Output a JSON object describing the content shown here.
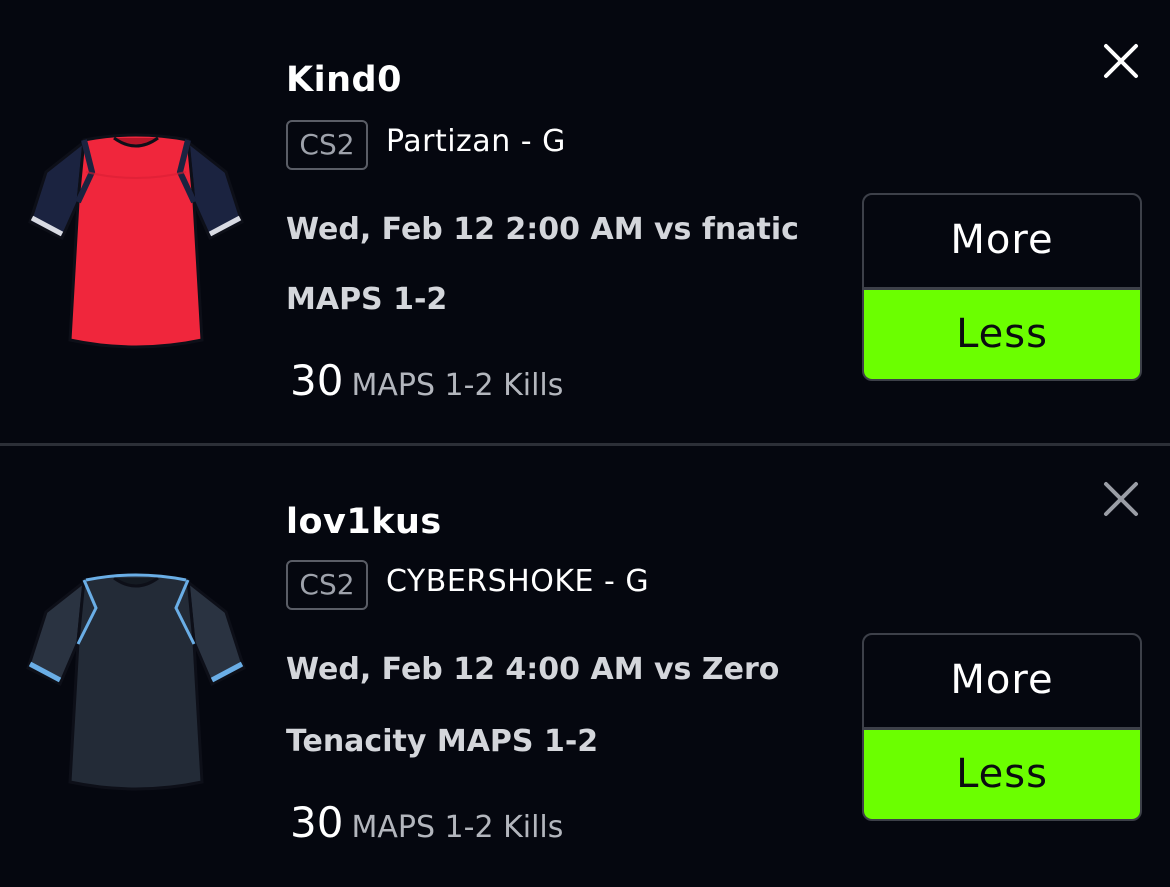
{
  "colors": {
    "background": "#05070f",
    "accent_selected": "#6bff00",
    "divider": "#2c2f37"
  },
  "projections": [
    {
      "player": "Kind0",
      "league": "CS2",
      "team": "Partizan - G",
      "match": "Wed, Feb 12 2:00 AM vs fnatic",
      "description": "MAPS 1-2",
      "line_value": "30",
      "stat": "MAPS 1-2 Kills",
      "more_label": "More",
      "less_label": "Less",
      "selected": "Less",
      "jersey_icon": "red-jersey-icon",
      "close_icon": "close-icon"
    },
    {
      "player": "lov1kus",
      "league": "CS2",
      "team": "CYBERSHOKE - G",
      "match": "Wed, Feb 12 4:00 AM vs Zero",
      "description": "Tenacity MAPS 1-2",
      "line_value": "30",
      "stat": "MAPS 1-2 Kills",
      "more_label": "More",
      "less_label": "Less",
      "selected": "Less",
      "jersey_icon": "dark-jersey-icon",
      "close_icon": "close-icon"
    }
  ]
}
